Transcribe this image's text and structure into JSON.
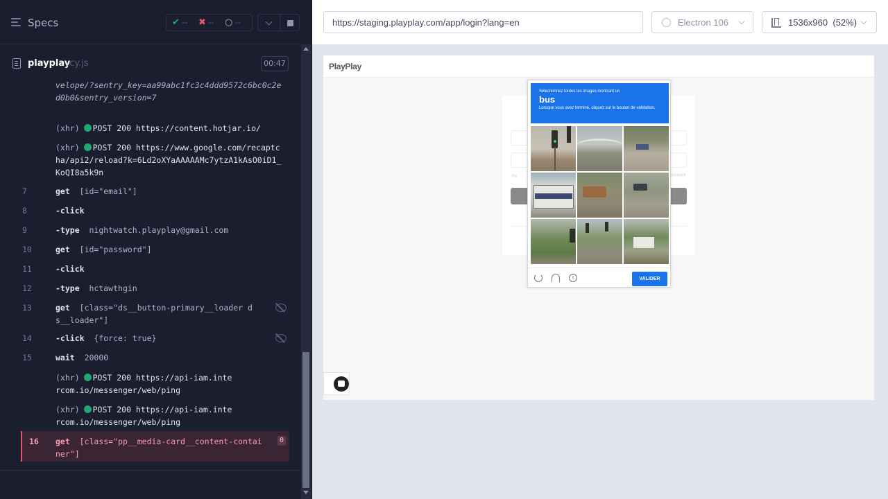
{
  "reporter": {
    "specs_label": "Specs",
    "stats": {
      "passed": "--",
      "failed": "--",
      "pending": "--"
    },
    "file": {
      "name": "playplay",
      "ext": ".cy.js",
      "duration": "00:47"
    },
    "log": [
      {
        "num": "",
        "kind": "url",
        "text": "velope/?sentry_key=aa99abc1fc3c4ddd9572c6bc0c2ed0b0&sentry_version=7"
      },
      {
        "num": "",
        "kind": "xhr",
        "prefix": "(xhr)",
        "text": "POST 200 https://content.hotjar.io/"
      },
      {
        "num": "",
        "kind": "xhr",
        "prefix": "(xhr)",
        "text": "POST 200 https://www.google.com/recaptcha/api2/reload?k=6Ld2oXYaAAAAAMc7ytzA1kAsO0iD1_KoQI8a5k9n"
      },
      {
        "num": "7",
        "kind": "cmd",
        "name": "get",
        "arg": "[id=\"email\"]"
      },
      {
        "num": "8",
        "kind": "cmd",
        "name": "-click",
        "arg": ""
      },
      {
        "num": "9",
        "kind": "cmd",
        "name": "-type",
        "arg": "nightwatch.playplay@gmail.com"
      },
      {
        "num": "10",
        "kind": "cmd",
        "name": "get",
        "arg": "[id=\"password\"]"
      },
      {
        "num": "11",
        "kind": "cmd",
        "name": "-click",
        "arg": ""
      },
      {
        "num": "12",
        "kind": "cmd",
        "name": "-type",
        "arg": "hctawthgin"
      },
      {
        "num": "13",
        "kind": "cmd",
        "name": "get",
        "arg": "[class=\"ds__button-primary__loader ds__loader\"]"
      },
      {
        "num": "14",
        "kind": "cmd",
        "name": "-click",
        "arg": "{force: true}"
      },
      {
        "num": "15",
        "kind": "cmd",
        "name": "wait",
        "arg": "20000"
      },
      {
        "num": "",
        "kind": "xhr",
        "prefix": "(xhr)",
        "text": "POST 200 https://api-iam.intercom.io/messenger/web/ping"
      },
      {
        "num": "",
        "kind": "xhr",
        "prefix": "(xhr)",
        "text": "POST 200 https://api-iam.intercom.io/messenger/web/ping"
      },
      {
        "num": "16",
        "kind": "fail",
        "name": "get",
        "arg": "[class=\"pp__media-card__content-container\"]",
        "count": "0"
      }
    ]
  },
  "aut": {
    "url": "https://staging.playplay.com/app/login?lang=en",
    "browser": "Electron 106",
    "viewport": "1536x960",
    "zoom": "(52%)",
    "app_logo": "PlayPlay",
    "login_ghost": {
      "remember": "Re",
      "forgot": "assword"
    },
    "captcha": {
      "line1": "Sélectionnez toutes les images montrant un",
      "target": "bus",
      "line2": "Lorsque vous avez terminé, cliquez sur le bouton de validation.",
      "info_glyph": "i",
      "verify": "VALIDER"
    }
  },
  "colors": {
    "pass": "#1fa971",
    "fail": "#e45770",
    "captcha_blue": "#1a73e8"
  },
  "icons": [
    "specs-menu-icon",
    "check-icon",
    "cross-icon",
    "spinner-icon",
    "chevron-down-icon",
    "stop-icon",
    "file-icon",
    "eye-off-icon",
    "browser-icon",
    "ruler-icon",
    "reload-icon",
    "headphones-icon",
    "info-icon",
    "intercom-icon"
  ]
}
